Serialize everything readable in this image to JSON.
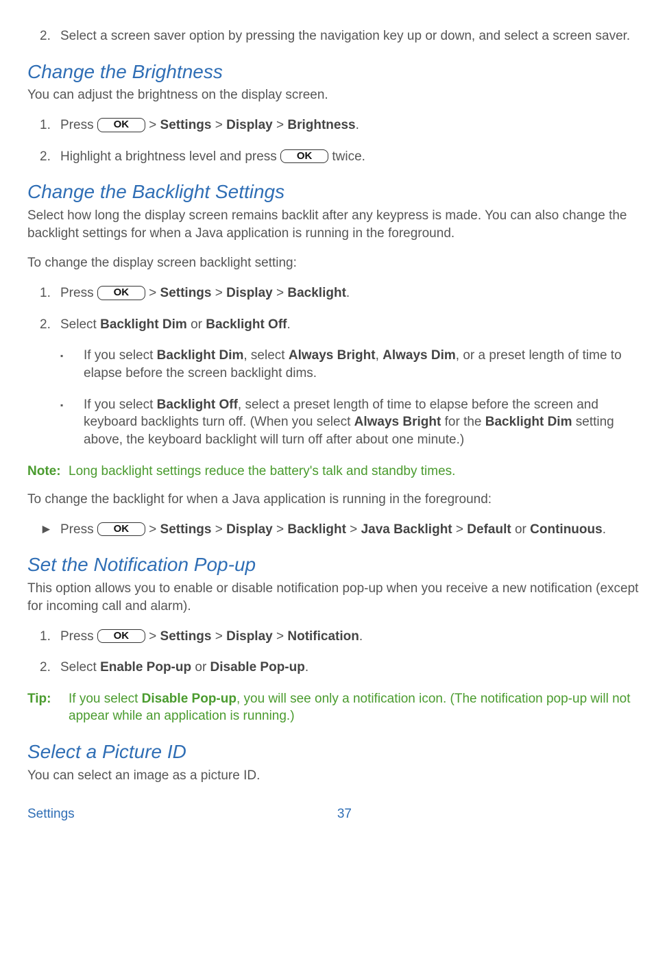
{
  "top_item": {
    "num": "2.",
    "text1": "Select a screen saver option by pressing the navigation key up or down, and select a screen saver."
  },
  "sec1": {
    "heading": "Change the Brightness",
    "intro": "You can adjust the brightness on the display screen.",
    "items": [
      {
        "num": "1.",
        "pre": "Press ",
        "ok": "OK",
        "gt": " > ",
        "b1": "Settings",
        "b2": "Display",
        "b3": "Brightness",
        "tail": "."
      },
      {
        "num": "2.",
        "pre": "Highlight a brightness level and press ",
        "ok": "OK",
        "tail": " twice."
      }
    ]
  },
  "sec2": {
    "heading": "Change the Backlight Settings",
    "intro": "Select how long the display screen remains backlit after any keypress is made. You can also change the backlight settings for when a Java application is running in the foreground.",
    "sub1": "To change the display screen backlight setting:",
    "items": [
      {
        "num": "1.",
        "pre": "Press ",
        "ok": "OK",
        "gt": " > ",
        "b1": "Settings",
        "b2": "Display",
        "b3": "Backlight",
        "tail": "."
      },
      {
        "num": "2.",
        "pre": "Select ",
        "b1": "Backlight Dim",
        "mid": " or ",
        "b2": "Backlight Off",
        "tail": "."
      }
    ],
    "bullets": [
      {
        "mark": "▪",
        "pre": "If you select ",
        "b1": "Backlight Dim",
        "mid1": ", select ",
        "b2": "Always Bright",
        "mid2": ", ",
        "b3": "Always Dim",
        "tail": ", or a preset length of time to elapse before the screen backlight dims."
      },
      {
        "mark": "▪",
        "pre": "If you select ",
        "b1": "Backlight Off",
        "mid1": ", select a preset length of time to elapse before the screen and keyboard backlights turn off. (When you select ",
        "b2": "Always Bright",
        "mid2": " for the ",
        "b3": "Backlight Dim",
        "tail": " setting above, the keyboard backlight will turn off after about one minute.)"
      }
    ],
    "note": {
      "label": "Note:",
      "text": "Long backlight settings reduce the battery's talk and standby times."
    },
    "sub2": "To change the backlight for when a Java application is running in the foreground:",
    "arrow": {
      "mark": "►",
      "pre": "Press ",
      "ok": "OK",
      "gt": " > ",
      "b1": "Settings",
      "b2": "Display",
      "b3": "Backlight",
      "b4": "Java Backlight",
      "b5": "Default",
      "mid": " or ",
      "b6": "Continuous",
      "tail": "."
    }
  },
  "sec3": {
    "heading": "Set the Notification Pop-up",
    "intro": "This option allows you to enable or disable notification pop-up when you receive a new notification (except for incoming call and alarm).",
    "items": [
      {
        "num": "1.",
        "pre": "Press ",
        "ok": "OK",
        "gt": " > ",
        "b1": "Settings",
        "b2": "Display",
        "b3": "Notification",
        "tail": "."
      },
      {
        "num": "2.",
        "pre": "Select ",
        "b1": "Enable Pop-up",
        "mid": " or ",
        "b2": "Disable Pop-up",
        "tail": "."
      }
    ],
    "tip": {
      "label": "Tip:",
      "pre": "If you select ",
      "b1": "Disable Pop-up",
      "tail": ", you will see only a notification icon. (The notification pop-up will not appear while an application is running.)"
    }
  },
  "sec4": {
    "heading": "Select a Picture ID",
    "intro": "You can select an image as a picture ID."
  },
  "footer": {
    "section": "Settings",
    "page": "37"
  }
}
